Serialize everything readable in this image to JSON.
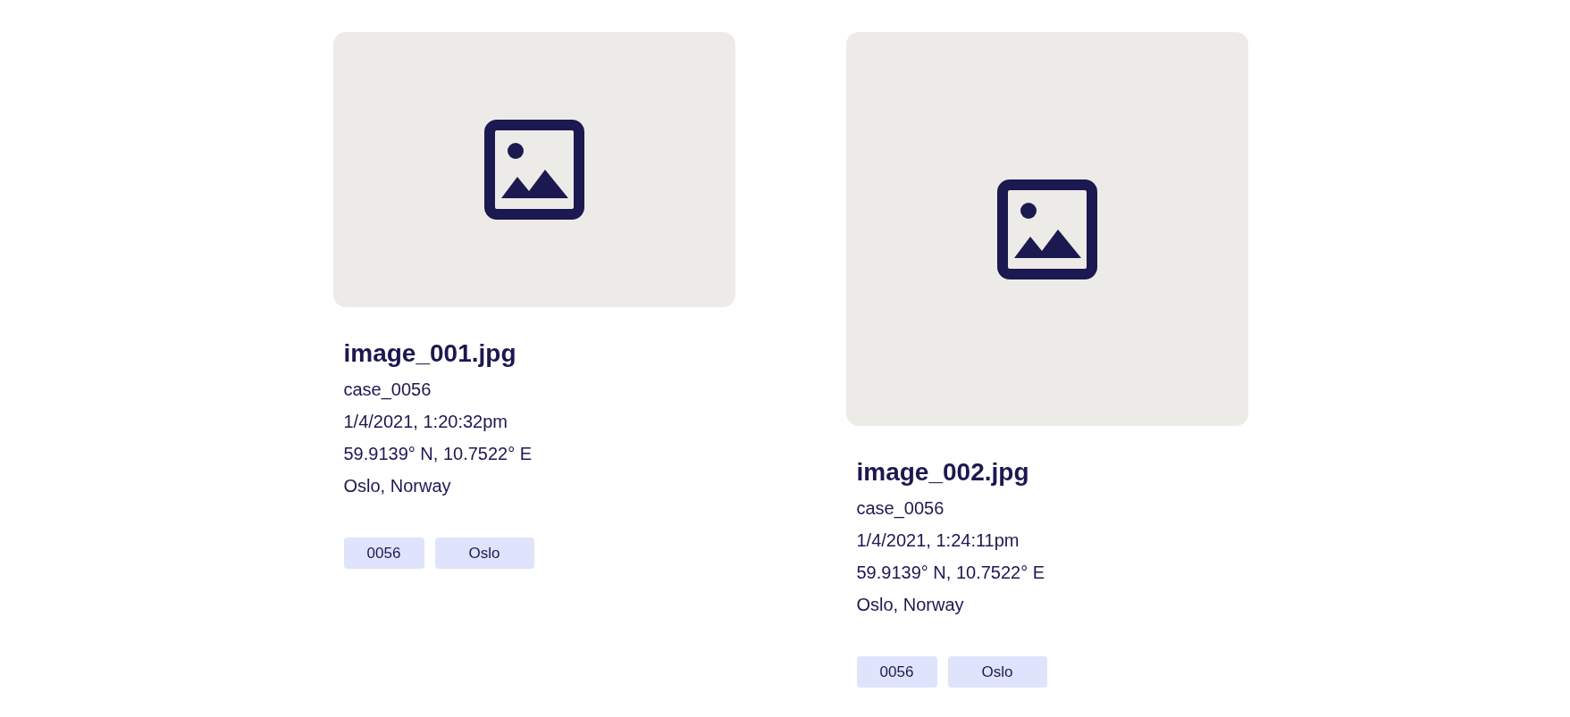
{
  "cards": [
    {
      "image": {
        "kind": "placeholder",
        "tall": false
      },
      "title": "image_001.jpg",
      "case": "case_0056",
      "timestamp": "1/4/2021, 1:20:32pm",
      "coordinates": "59.9139° N, 10.7522° E",
      "location": "Oslo, Norway",
      "tags": [
        "0056",
        "Oslo"
      ]
    },
    {
      "image": {
        "kind": "placeholder",
        "tall": true
      },
      "title": "image_002.jpg",
      "case": "case_0056",
      "timestamp": "1/4/2021, 1:24:11pm",
      "coordinates": "59.9139° N, 10.7522° E",
      "location": "Oslo, Norway",
      "tags": [
        "0056",
        "Oslo"
      ]
    }
  ]
}
